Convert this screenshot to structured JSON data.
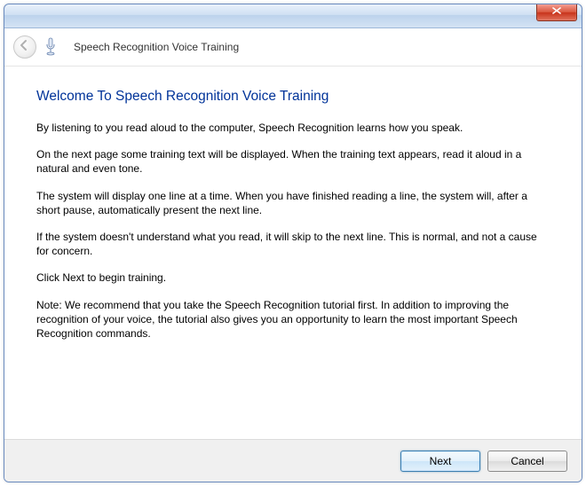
{
  "header": {
    "title": "Speech Recognition Voice Training"
  },
  "page": {
    "title": "Welcome To Speech Recognition Voice Training",
    "p1": "By listening to you read aloud to the computer, Speech Recognition learns how you speak.",
    "p2": "On the next page some training text will be displayed. When the training text appears, read it aloud in a natural and even tone.",
    "p3": "The system will display one line at a time. When you have finished reading a line, the system will, after a short pause, automatically present the next line.",
    "p4": "If the system doesn't understand what you read, it will skip to the next line. This is normal, and not a cause for concern.",
    "p5": "Click Next to begin training.",
    "p6": "Note: We recommend that you take the Speech Recognition tutorial first. In addition to improving the recognition of your voice, the tutorial also gives you an opportunity to learn the most important Speech Recognition commands."
  },
  "footer": {
    "next_label": "Next",
    "cancel_label": "Cancel"
  }
}
